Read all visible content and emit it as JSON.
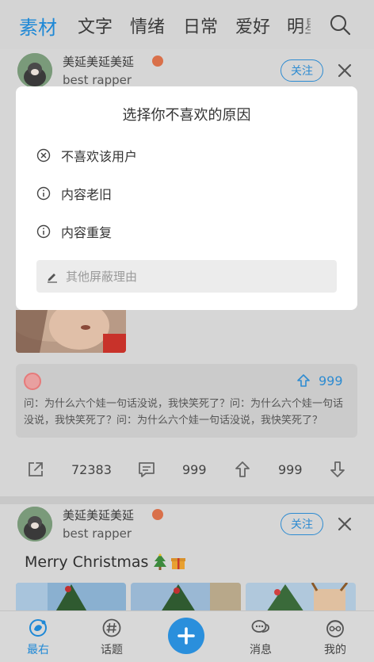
{
  "top_tabs": [
    {
      "label": "素材",
      "active": true
    },
    {
      "label": "文字"
    },
    {
      "label": "情绪"
    },
    {
      "label": "日常"
    },
    {
      "label": "爱好"
    },
    {
      "label": "明星"
    }
  ],
  "post1": {
    "username": "美延美延美延",
    "group": "best rapper",
    "follow_label": "关注"
  },
  "dialog": {
    "title": "选择你不喜欢的原因",
    "reasons": [
      {
        "label": "不喜欢该用户",
        "icon": "circle-x-icon"
      },
      {
        "label": "内容老旧",
        "icon": "info-circle-icon"
      },
      {
        "label": "内容重复",
        "icon": "info-circle-icon"
      }
    ],
    "other_placeholder": "其他屏蔽理由"
  },
  "qa": {
    "upvotes": "999",
    "text": "问：为什么六个娃一句话没说，我快笑死了？问：为什么六个娃一句话没说，我快笑死了？问：为什么六个娃一句话没说，我快笑死了？"
  },
  "actions": {
    "share_count": "72383",
    "comment_count": "999",
    "up_count": "999"
  },
  "post2": {
    "username": "美延美延美延",
    "group": "best rapper",
    "follow_label": "关注",
    "text": "Merry Christmas"
  },
  "bottom_nav": [
    {
      "label": "最右",
      "icon": "home-icon",
      "active": true
    },
    {
      "label": "话题",
      "icon": "topic-hash-icon"
    },
    {
      "label": "消息",
      "icon": "message-icon"
    },
    {
      "label": "我的",
      "icon": "profile-icon"
    }
  ],
  "colors": {
    "accent": "#1e88d6",
    "fab": "#2a8fdc"
  }
}
